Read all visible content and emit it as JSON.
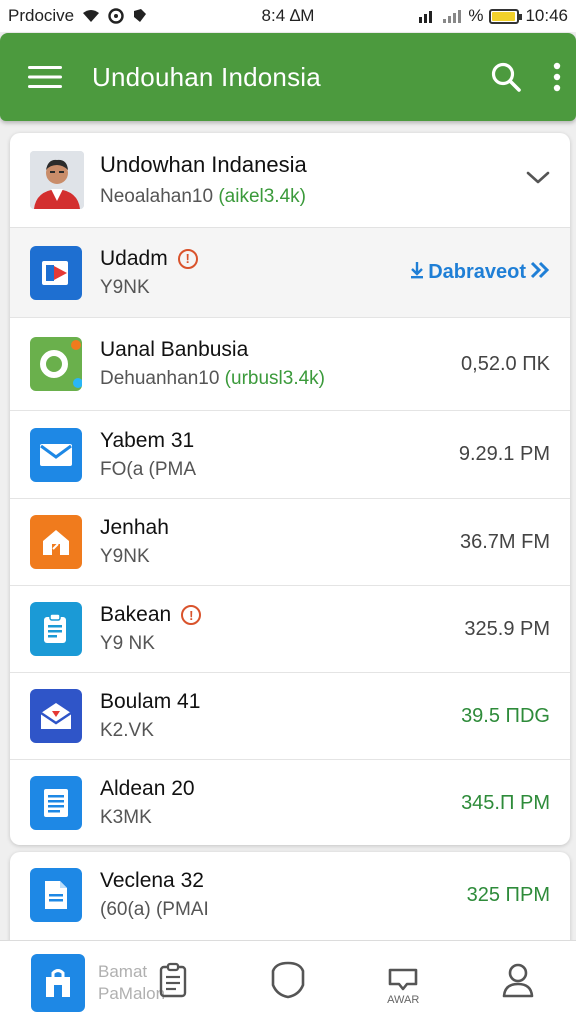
{
  "status_bar": {
    "carrier": "Prdocive",
    "time_center": "8:4 ∆M",
    "battery_percent_label": "%",
    "time_right": "10:46",
    "battery_level": 0.85
  },
  "app_bar": {
    "title": "Undouhan Indonsia",
    "color": "#4c9a3e"
  },
  "account": {
    "name": "Undowhan Indanesia",
    "subtitle_prefix": "Neoalahan10 ",
    "subtitle_green": "(aikel3.4k)"
  },
  "apps": [
    {
      "title": "Udadm",
      "subtitle": "Y9NK",
      "meta": "Dabraveot",
      "meta_style": "blue",
      "icon": "play-slide-icon",
      "color": "#1e6fd1",
      "warning": true,
      "highlight": true
    },
    {
      "title": "Uanal Banbusia",
      "subtitle_prefix": "Dehuanhan10 ",
      "subtitle_green": "(urbusl3.4k)",
      "meta": "0,52.0 ΠΚ",
      "meta_style": "gray",
      "icon": "ring-icon",
      "color": "#6ab04c",
      "warning": false
    },
    {
      "title": "Yabem 31",
      "subtitle": "FO(a (PMA",
      "meta": "9.29.1 PM",
      "meta_style": "gray",
      "icon": "mail-icon",
      "color": "#1e88e5",
      "warning": false
    },
    {
      "title": "Jenhah",
      "subtitle": "Y9NK",
      "meta": "36.7M FM",
      "meta_style": "gray",
      "icon": "home-icon",
      "color": "#f07b1d",
      "warning": false
    },
    {
      "title": "Bakean",
      "subtitle": "Y9 NK",
      "meta": "325.9 PM",
      "meta_style": "gray",
      "icon": "clipboard-icon",
      "color": "#1b9ad6",
      "warning": true
    },
    {
      "title": "Boulam 41",
      "subtitle": "K2.VK",
      "meta": "39.5 ΠDG",
      "meta_style": "green",
      "icon": "envelope-open-icon",
      "color": "#2f55c8",
      "warning": false
    },
    {
      "title": "Aldean 20",
      "subtitle": "K3MK",
      "meta": "345.Π PM",
      "meta_style": "green",
      "icon": "document-list-icon",
      "color": "#1e88e5",
      "warning": false
    }
  ],
  "partial_app": {
    "title": "Veclena 32",
    "subtitle": "(60(a) (PMAI",
    "meta": "325 ΠPM",
    "meta_style": "green",
    "icon": "document-icon",
    "color": "#1e88e5"
  },
  "bottom_nav": {
    "overlay_label_line1": "Bamat",
    "overlay_label_line2": "PaMalon",
    "small_label": "AWAR"
  }
}
